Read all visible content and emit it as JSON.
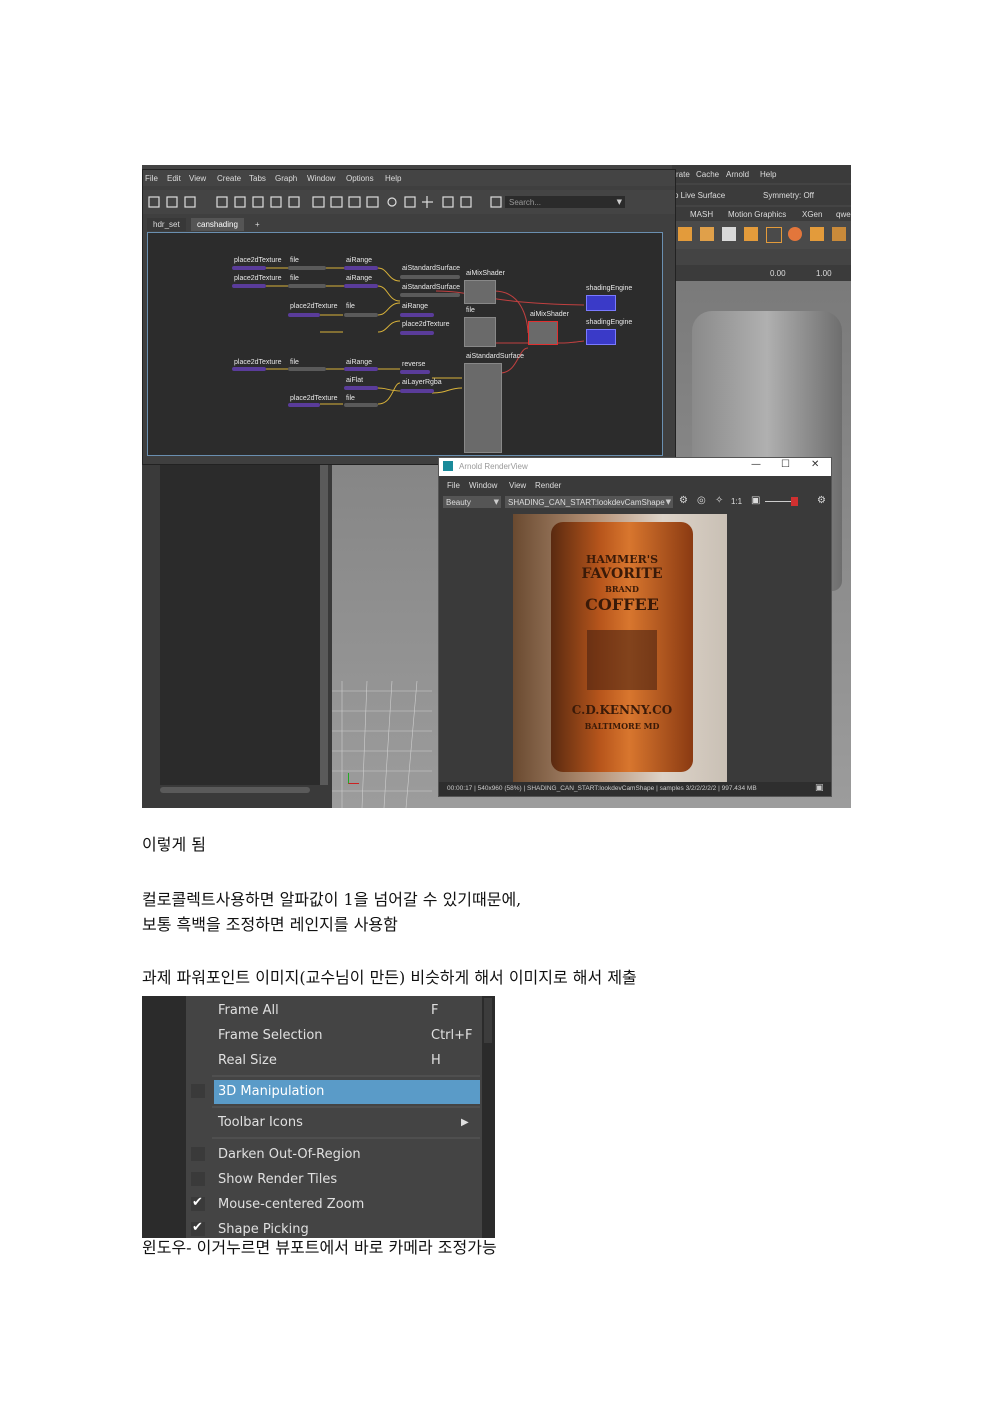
{
  "shot1": {
    "menubar": [
      "File",
      "Edit",
      "View",
      "Create",
      "Tabs",
      "Graph",
      "Window",
      "Options",
      "Help"
    ],
    "search_placeholder": "Search...",
    "tabs": [
      "hdr_set",
      "canshading",
      "+"
    ],
    "maya_menu": [
      "rate",
      "Cache",
      "Arnold",
      "Help"
    ],
    "live_surface": "o Live Surface",
    "symmetry": "Symmetry: Off",
    "shelf_tabs": [
      "MASH",
      "Motion Graphics",
      "XGen",
      "qwe"
    ],
    "field_a": "0.00",
    "field_b": "1.00",
    "nodes": {
      "place2dTexture_1": "place2dTexture",
      "file_1": "file",
      "aiRange_1": "aiRange",
      "place2dTexture_2": "place2dTexture",
      "file_2": "file",
      "aiRange_2": "aiRange",
      "aiStandardSurface_1": "aiStandardSurface",
      "aiStandardSurface_2": "aiStandardSurface",
      "aiMixShader_1": "aiMixShader",
      "place2dTexture_3": "place2dTexture",
      "file_3": "file",
      "aiRange_3": "aiRange",
      "file_4": "file",
      "aiMixShader_2": "aiMixShader",
      "place2dTexture_4": "place2dTexture",
      "aiStandardSurface_3": "aiStandardSurface",
      "shadingEngine_1": "shadingEngine",
      "shadingEngine_2": "shadingEngine",
      "place2dTexture_5": "place2dTexture",
      "file_5": "file",
      "aiRange_4": "aiRange",
      "reverse": "reverse",
      "aiFlat": "aiFlat",
      "aiLayerRgba": "aiLayerRgba",
      "place2dTexture_6": "place2dTexture",
      "file_6": "file"
    },
    "renderview": {
      "title": "Arnold RenderView",
      "menu": [
        "File",
        "Window",
        "View",
        "Render"
      ],
      "aov": "Beauty",
      "camera": "SHADING_CAN_START:lookdevCamShape",
      "ratio": "1:1",
      "status": "00:00:17 | 540x960 (58%) | SHADING_CAN_START:lookdevCamShape | samples 3/2/2/2/2/2 | 997.434 MB",
      "can_text": [
        "HAMMER'S",
        "FAVORITE",
        "BRAND",
        "COFFEE",
        "C.D.KENNY.CO",
        "BALTIMORE MD"
      ]
    }
  },
  "caption1": "이렇게 됨",
  "note_line1": "컬로콜렉트사용하면 알파값이 1을 넘어갈 수 있기때문에,",
  "note_line2": "보통 흑백을 조정하면 레인지를 사용함",
  "assignment": "과제 파워포인트 이미지(교수님이 만든) 비슷하게 해서 이미지로 해서 제출",
  "menu": {
    "items": [
      {
        "label": "Frame All",
        "shortcut": "F"
      },
      {
        "label": "Frame Selection",
        "shortcut": "Ctrl+F"
      },
      {
        "label": "Real Size",
        "shortcut": "H"
      },
      {
        "label": "3D Manipulation"
      },
      {
        "label": "Toolbar Icons"
      },
      {
        "label": "Darken Out-Of-Region"
      },
      {
        "label": "Show Render Tiles"
      },
      {
        "label": "Mouse-centered Zoom"
      },
      {
        "label": "Shape Picking"
      }
    ],
    "submenu_arrow": "▶",
    "check": "✔"
  },
  "caption2": "윈도우- 이거누르면 뷰포트에서 바로 카메라 조정가능",
  "colors": {
    "highlight": "#5a9bc8",
    "node_purple": "#5a3c9a",
    "link_yellow": "#d8b23a",
    "shading_blue": "#3a3ac8"
  }
}
